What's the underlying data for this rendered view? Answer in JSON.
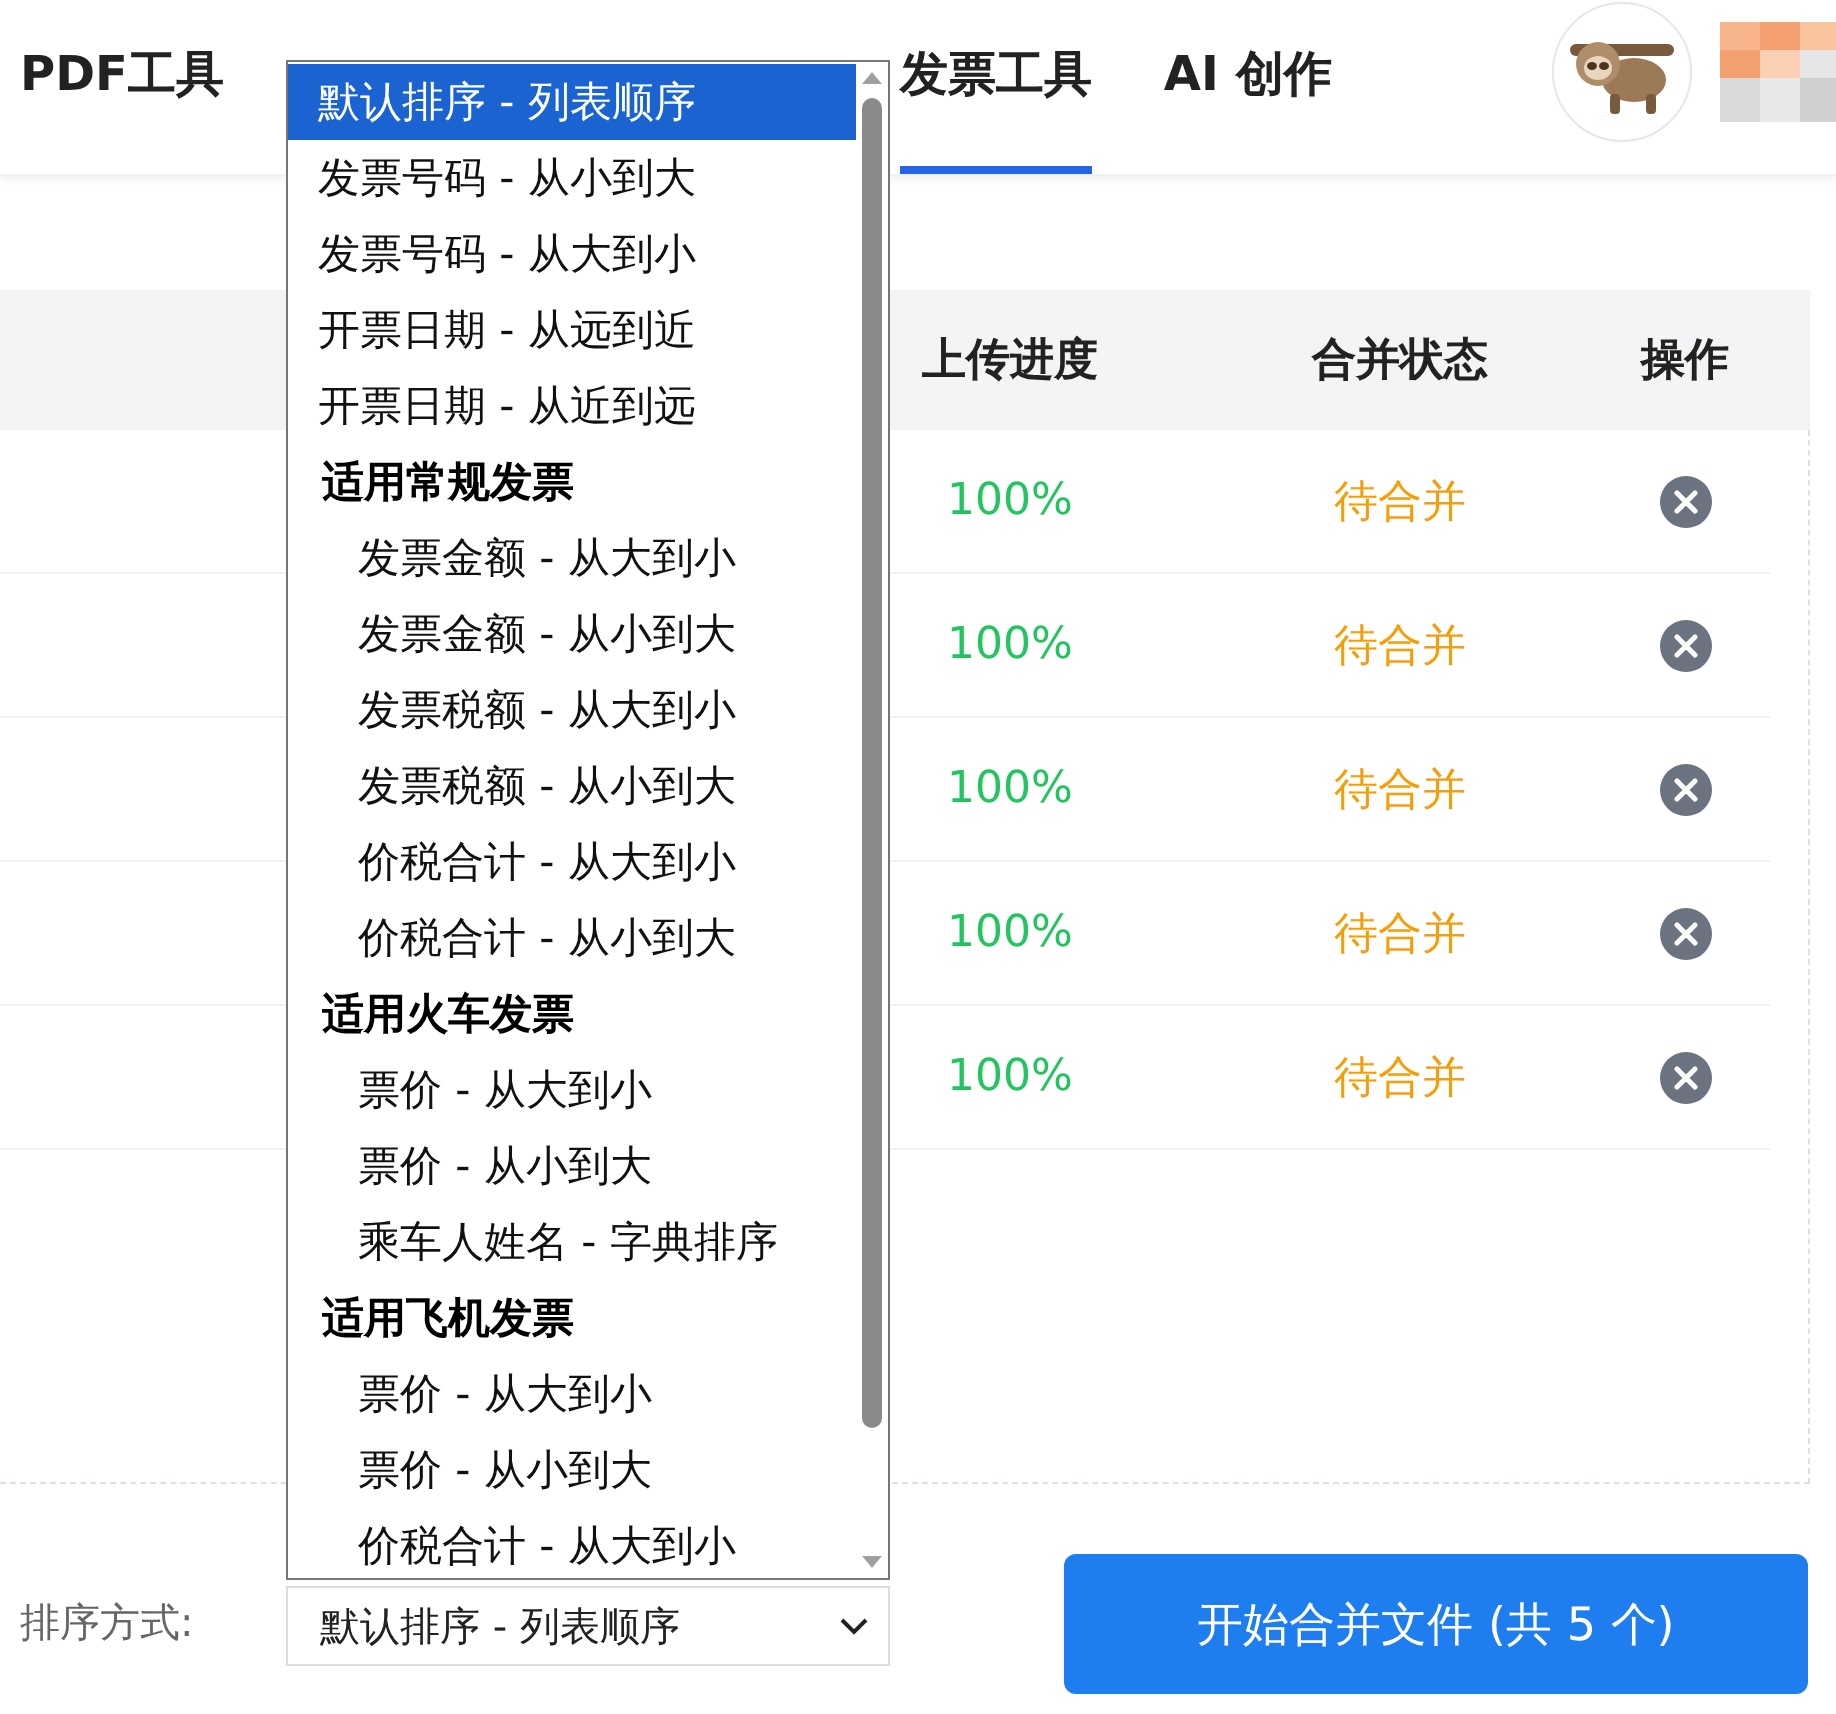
{
  "nav": {
    "tabs": [
      {
        "label": "PDF工具",
        "selected": false
      },
      {
        "label": "发票工具",
        "selected": true
      },
      {
        "label": "AI 创作",
        "selected": false
      }
    ]
  },
  "table": {
    "columns": [
      "上传进度",
      "合并状态",
      "操作"
    ],
    "rows": [
      {
        "progress": "100%",
        "status": "待合并"
      },
      {
        "progress": "100%",
        "status": "待合并"
      },
      {
        "progress": "100%",
        "status": "待合并"
      },
      {
        "progress": "100%",
        "status": "待合并"
      },
      {
        "progress": "100%",
        "status": "待合并"
      }
    ]
  },
  "sort": {
    "label": "排序方式:",
    "value": "默认排序 - 列表顺序",
    "options": [
      {
        "kind": "option",
        "label": "默认排序 - 列表顺序",
        "selected": true
      },
      {
        "kind": "option",
        "label": "发票号码 - 从小到大",
        "selected": false
      },
      {
        "kind": "option",
        "label": "发票号码 - 从大到小",
        "selected": false
      },
      {
        "kind": "option",
        "label": "开票日期 - 从远到近",
        "selected": false
      },
      {
        "kind": "option",
        "label": "开票日期 - 从近到远",
        "selected": false
      },
      {
        "kind": "group",
        "label": "适用常规发票",
        "children": [
          {
            "kind": "option",
            "label": "发票金额 - 从大到小",
            "selected": false
          },
          {
            "kind": "option",
            "label": "发票金额 - 从小到大",
            "selected": false
          },
          {
            "kind": "option",
            "label": "发票税额 - 从大到小",
            "selected": false
          },
          {
            "kind": "option",
            "label": "发票税额 - 从小到大",
            "selected": false
          },
          {
            "kind": "option",
            "label": "价税合计 - 从大到小",
            "selected": false
          },
          {
            "kind": "option",
            "label": "价税合计 - 从小到大",
            "selected": false
          }
        ]
      },
      {
        "kind": "group",
        "label": "适用火车发票",
        "children": [
          {
            "kind": "option",
            "label": "票价 - 从大到小",
            "selected": false
          },
          {
            "kind": "option",
            "label": "票价 - 从小到大",
            "selected": false
          },
          {
            "kind": "option",
            "label": "乘车人姓名 - 字典排序",
            "selected": false
          }
        ]
      },
      {
        "kind": "group",
        "label": "适用飞机发票",
        "children": [
          {
            "kind": "option",
            "label": "票价 - 从大到小",
            "selected": false
          },
          {
            "kind": "option",
            "label": "票价 - 从小到大",
            "selected": false
          },
          {
            "kind": "option",
            "label": "价税合计 - 从大到小",
            "selected": false
          }
        ]
      }
    ]
  },
  "merge_button": "开始合并文件 (共 5 个)"
}
